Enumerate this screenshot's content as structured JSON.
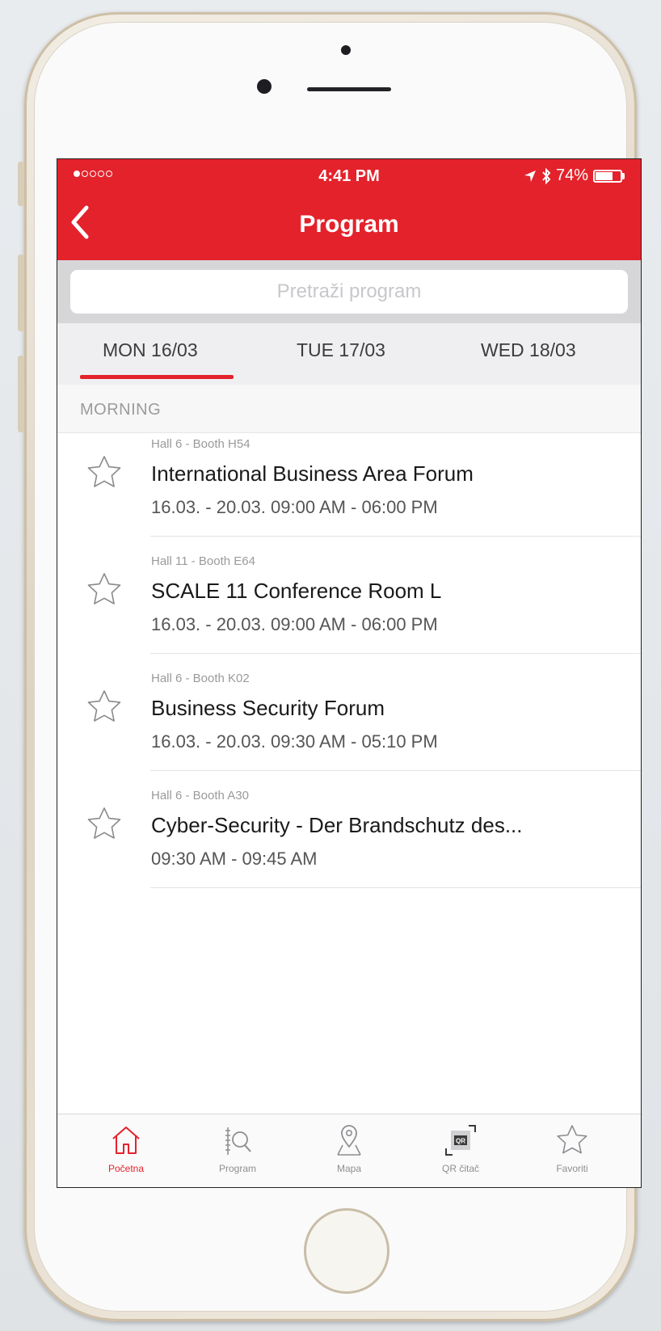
{
  "status_bar": {
    "time": "4:41 PM",
    "battery": "74%",
    "battery_level": 0.74,
    "signal_bars_filled": 1,
    "signal_bars_total": 5
  },
  "nav": {
    "title": "Program"
  },
  "search": {
    "placeholder": "Pretraži program"
  },
  "day_tabs": [
    {
      "label": "MON 16/03",
      "selected": true
    },
    {
      "label": "TUE 17/03",
      "selected": false
    },
    {
      "label": "WED 18/03",
      "selected": false
    }
  ],
  "section": {
    "label": "MORNING"
  },
  "events": [
    {
      "location": "Hall 6 - Booth H54",
      "title": "International Business Area Forum",
      "time": "16.03. - 20.03. 09:00 AM - 06:00 PM"
    },
    {
      "location": "Hall 11 - Booth E64",
      "title": "SCALE 11 Conference Room L",
      "time": "16.03. - 20.03. 09:00 AM - 06:00 PM"
    },
    {
      "location": "Hall 6 - Booth K02",
      "title": "Business Security Forum",
      "time": "16.03. - 20.03. 09:30 AM - 05:10 PM"
    },
    {
      "location": "Hall 6 - Booth A30",
      "title": "Cyber-Security - Der Brandschutz des...",
      "time": "09:30 AM - 09:45 AM"
    }
  ],
  "tabbar": {
    "items": [
      {
        "label": "Početna",
        "icon": "home-icon",
        "active": true
      },
      {
        "label": "Program",
        "icon": "program-search-icon",
        "active": false
      },
      {
        "label": "Mapa",
        "icon": "map-pin-icon",
        "active": false
      },
      {
        "label": "QR čitač",
        "icon": "qr-code-icon",
        "active": false
      },
      {
        "label": "Favoriti",
        "icon": "star-icon",
        "active": false
      }
    ]
  },
  "colors": {
    "brand_red": "#e4222b",
    "active_tab": "#e4222b",
    "inactive_icon": "#8e8e93"
  }
}
